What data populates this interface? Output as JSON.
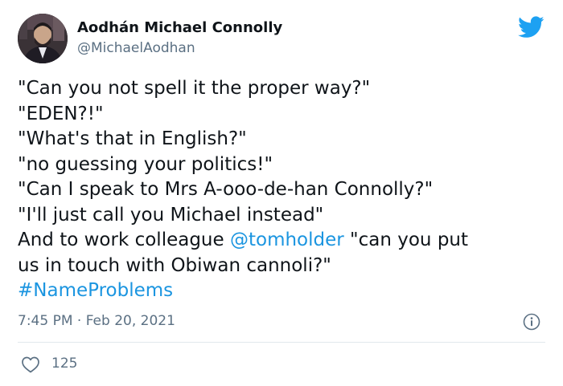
{
  "author": {
    "display_name": "Aodhán Michael Connolly",
    "handle": "@MichaelAodhan"
  },
  "tweet": {
    "lines": [
      "\"Can you not spell it the proper way?\"",
      "\"EDEN?!\"",
      "\"What's that in English?\"",
      "\"no guessing your politics!\"",
      "\"Can I speak to Mrs A-ooo-de-han Connolly?\"",
      "\"I'll just call you Michael instead\""
    ],
    "line7_prefix": "And to work colleague ",
    "mention": "@tomholder",
    "line7_suffix": " \"can you put",
    "line8": "us in touch with Obiwan cannoli?\"",
    "hashtag": "#NameProblems"
  },
  "meta": {
    "timestamp": "7:45 PM · Feb 20, 2021",
    "like_count": "125"
  },
  "icons": {
    "brand": "twitter-bird-icon",
    "info": "info-icon",
    "like": "heart-icon"
  },
  "colors": {
    "link": "#1b95e0",
    "secondary_text": "#5b7083",
    "brand_blue": "#1da1f2"
  }
}
